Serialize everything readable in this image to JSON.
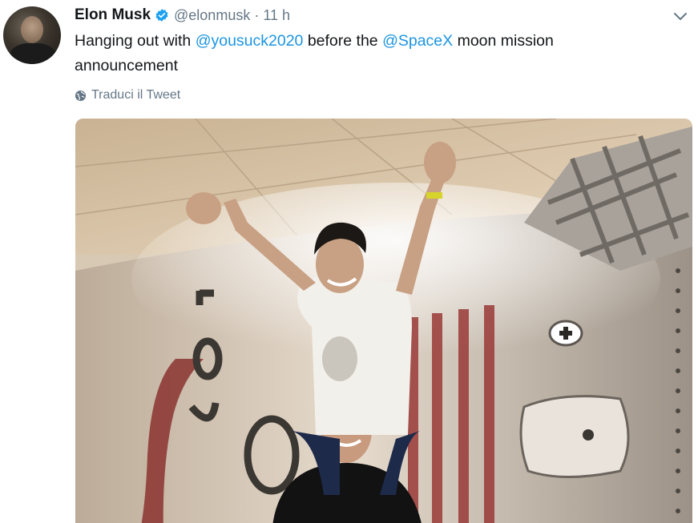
{
  "tweet": {
    "author_name": "Elon Musk",
    "handle": "@elonmusk",
    "separator": "·",
    "time": "11 h",
    "text_parts": {
      "t1": "Hanging out with ",
      "mention1": "@yousuck2020",
      "t2": " before the ",
      "mention2": "@SpaceX",
      "t3": " moon mission announcement"
    },
    "translate_label": "Traduci il Tweet"
  },
  "icons": {
    "verified": "verified-badge-icon",
    "caret": "chevron-down-icon",
    "translate": "globe-icon"
  },
  "colors": {
    "link": "#1b95e0",
    "secondary_text": "#657786",
    "primary_text": "#14171a",
    "verified": "#1da1f2"
  }
}
